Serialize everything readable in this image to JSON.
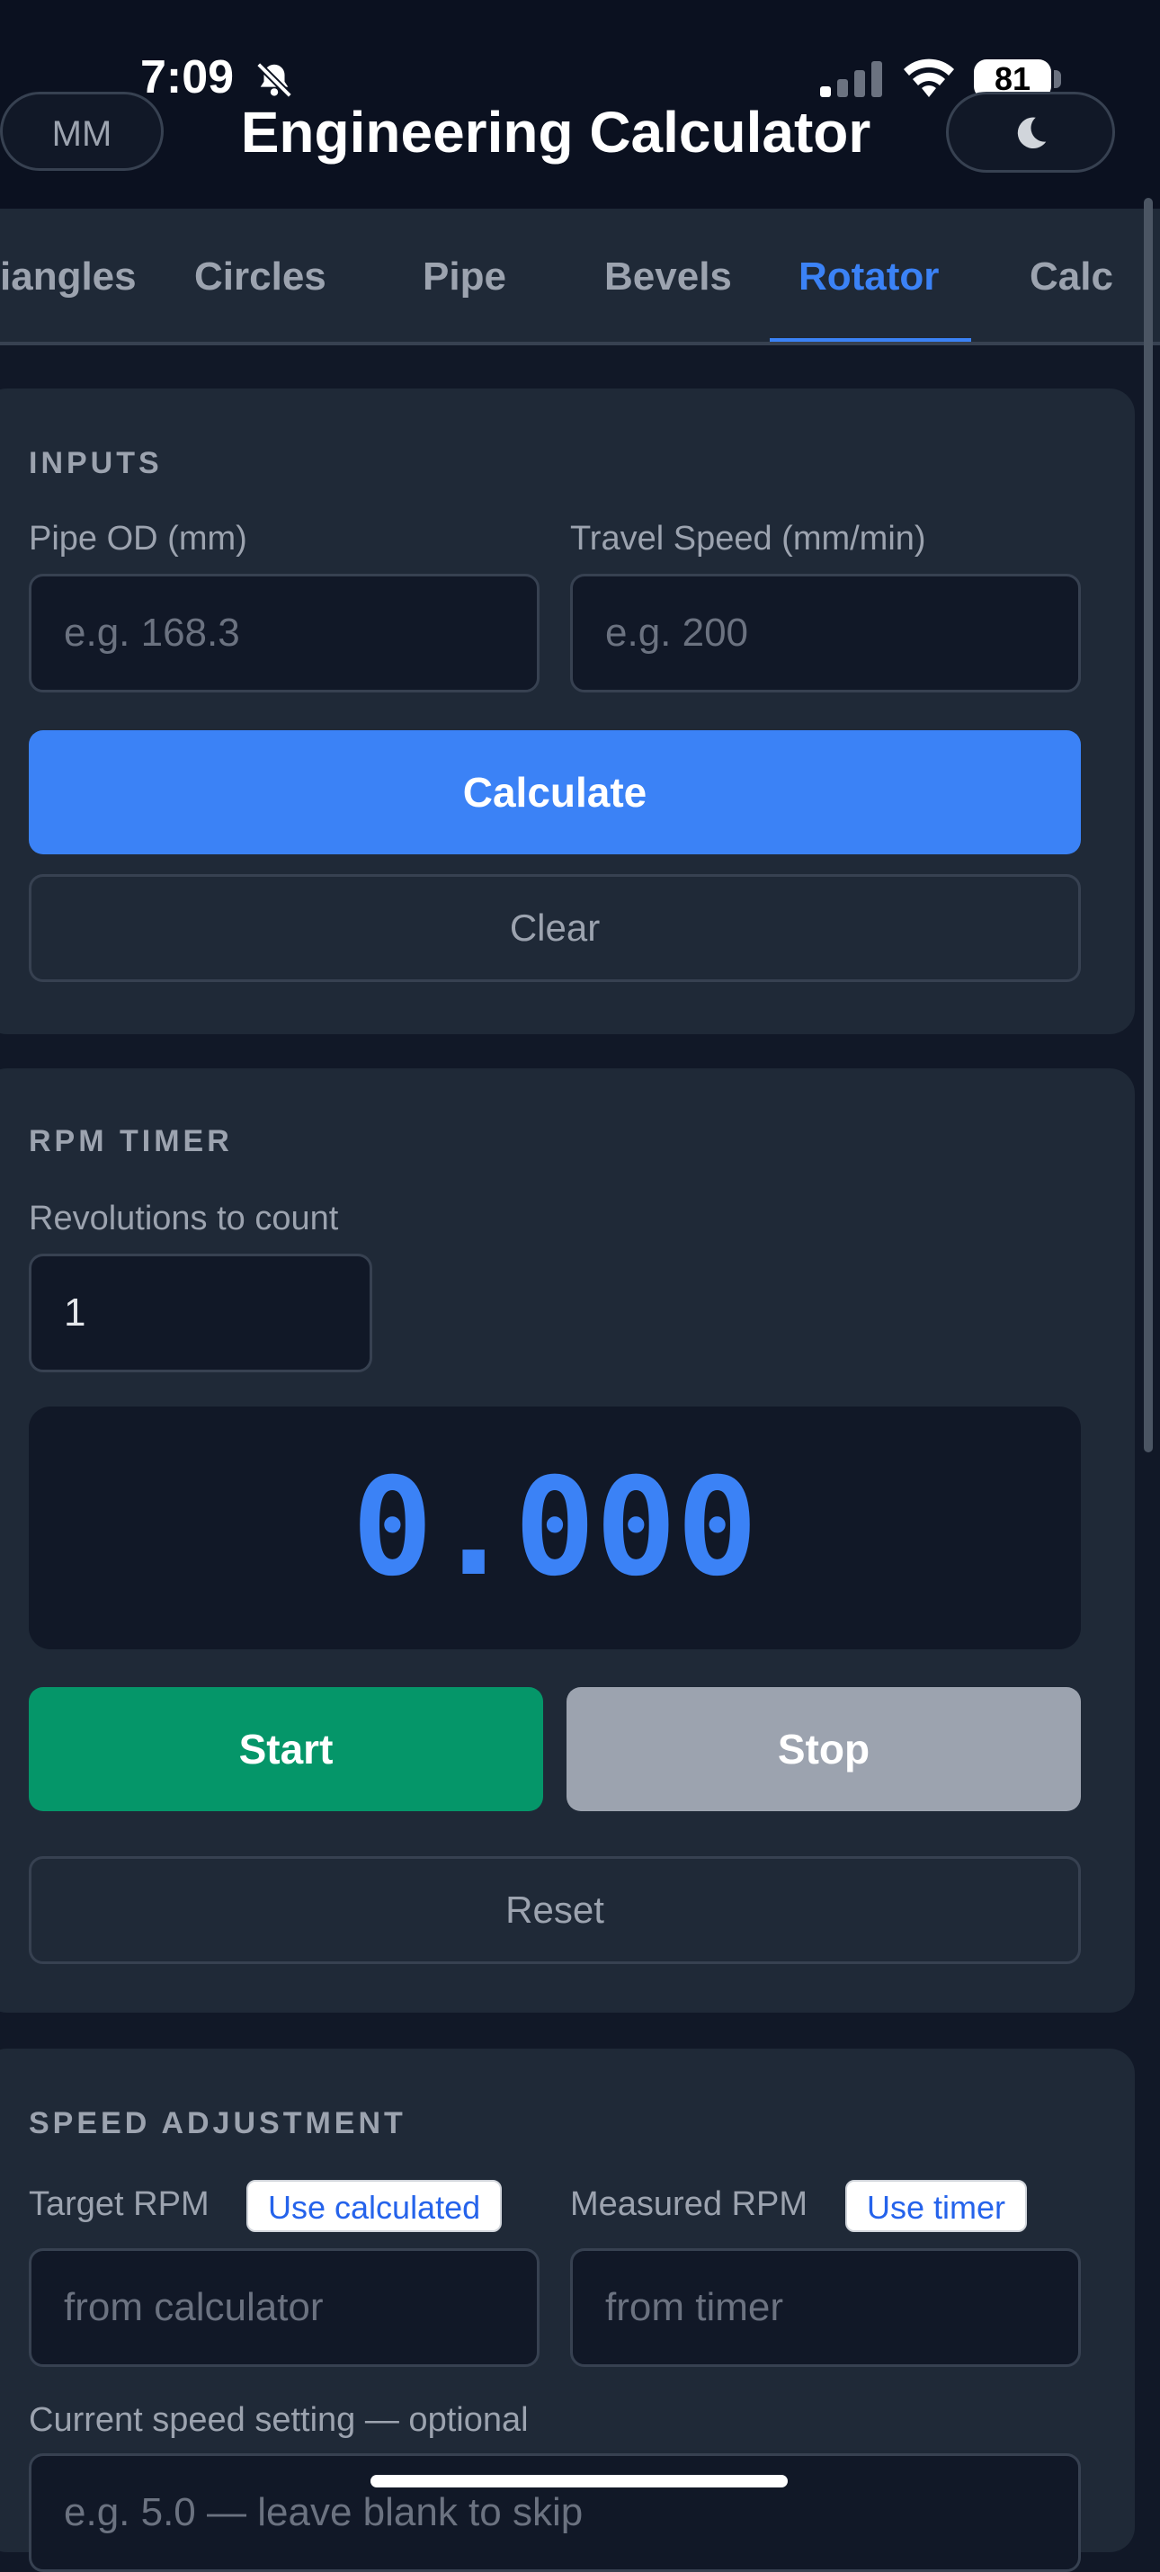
{
  "status_bar": {
    "time": "7:09",
    "battery": "81"
  },
  "header": {
    "units_label": "MM",
    "title": "Engineering Calculator"
  },
  "tabs": [
    {
      "label": "iangles"
    },
    {
      "label": "Circles"
    },
    {
      "label": "Pipe"
    },
    {
      "label": "Bevels"
    },
    {
      "label": "Rotator",
      "active": true
    },
    {
      "label": "Calc"
    }
  ],
  "inputs_section": {
    "title": "INPUTS",
    "pipe_od": {
      "label": "Pipe OD (mm)",
      "placeholder": "e.g. 168.3",
      "value": ""
    },
    "travel_speed": {
      "label": "Travel Speed (mm/min)",
      "placeholder": "e.g. 200",
      "value": ""
    },
    "calculate_label": "Calculate",
    "clear_label": "Clear"
  },
  "rpm_timer": {
    "title": "RPM TIMER",
    "revolutions_label": "Revolutions to count",
    "revolutions_value": "1",
    "display": "0.000",
    "start_label": "Start",
    "stop_label": "Stop",
    "reset_label": "Reset"
  },
  "speed_adjustment": {
    "title": "SPEED ADJUSTMENT",
    "target_rpm": {
      "label": "Target RPM",
      "chip": "Use calculated",
      "placeholder": "from calculator"
    },
    "measured_rpm": {
      "label": "Measured RPM",
      "chip": "Use timer",
      "placeholder": "from timer"
    },
    "current_speed": {
      "label": "Current speed setting — optional",
      "placeholder": "e.g. 5.0 — leave blank to skip"
    }
  },
  "colors": {
    "background": "#111827",
    "card": "#1f2937",
    "accent": "#3b82f6",
    "start": "#059669",
    "stop": "#9ca3af"
  },
  "icons": [
    "bell-slash-icon",
    "signal-icon",
    "wifi-icon",
    "battery-icon",
    "moon-icon"
  ]
}
